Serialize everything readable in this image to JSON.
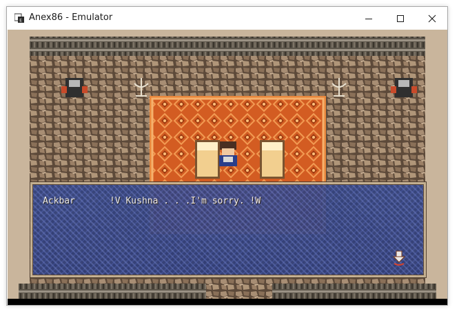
{
  "window": {
    "title": "Anex86 - Emulator",
    "controls": [
      "minimize",
      "maximize",
      "close"
    ]
  },
  "icons": {
    "app": "app-icon",
    "minimize": "minimize-icon",
    "maximize": "maximize-icon",
    "close": "close-icon",
    "next": "next-page-arrow-icon"
  },
  "game": {
    "dialog": {
      "speaker": "Ackbar",
      "line": "!V Kushna . . .I'm sorry. !W"
    }
  },
  "colors": {
    "carpet_orange": "#d9622a",
    "dialog_blue": "#34447f",
    "stone": "#8c7159"
  }
}
